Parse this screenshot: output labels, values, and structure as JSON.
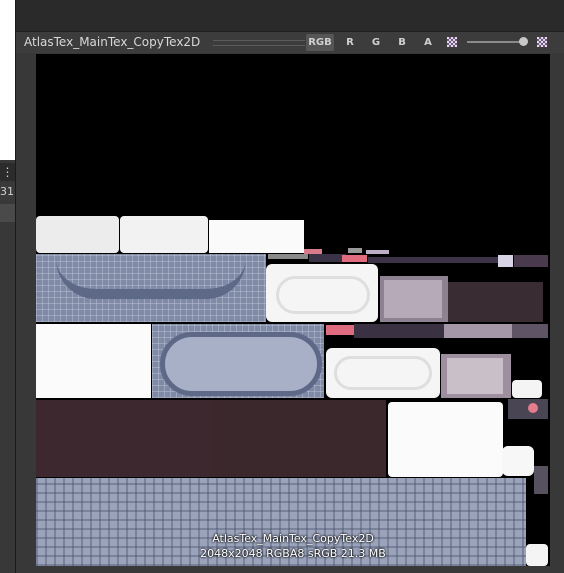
{
  "left_panel": {
    "menu_glyph": "⋮",
    "partial_number": "31"
  },
  "toolbar": {
    "title": "AtlasTex_MainTex_CopyTex2D",
    "channels": [
      "RGB",
      "R",
      "G",
      "B",
      "A"
    ],
    "active_channel": "RGB",
    "mip_slider_value": 1.0
  },
  "preview": {
    "info_name": "AtlasTex_MainTex_CopyTex2D",
    "info_details": "2048x2048  RGBA8 sRGB   21.3 MB"
  },
  "colors": {
    "panel_bg": "#383838",
    "toolbar_bg": "#3c3c3c",
    "canvas_bg": "#000000",
    "active_button": "#565656"
  }
}
